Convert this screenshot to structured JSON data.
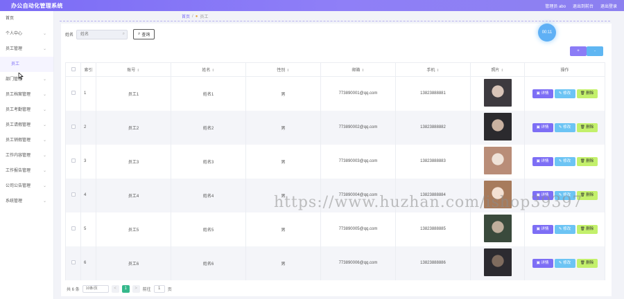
{
  "app": {
    "title": "办公自动化管理系统"
  },
  "header": {
    "admin_label": "管理员 abo",
    "back_label": "退出到前台",
    "logout_label": "退出登录"
  },
  "sidebar": {
    "items": [
      {
        "label": "首页",
        "has_arrow": false
      },
      {
        "label": "个人中心",
        "has_arrow": true
      },
      {
        "label": "员工管理",
        "has_arrow": true,
        "children": [
          "员工"
        ]
      },
      {
        "label": "部门管理",
        "has_arrow": true
      },
      {
        "label": "员工档案管理",
        "has_arrow": true
      },
      {
        "label": "员工考勤管理",
        "has_arrow": true
      },
      {
        "label": "员工请假管理",
        "has_arrow": true
      },
      {
        "label": "员工销假管理",
        "has_arrow": true
      },
      {
        "label": "工作内容管理",
        "has_arrow": true
      },
      {
        "label": "工作报告管理",
        "has_arrow": true
      },
      {
        "label": "公司公告管理",
        "has_arrow": true
      },
      {
        "label": "系统管理",
        "has_arrow": true
      }
    ]
  },
  "breadcrumb": {
    "home": "首页",
    "current": "员工"
  },
  "search": {
    "label": "姓名",
    "placeholder": "姓名",
    "button": "查询"
  },
  "timer": "00:11",
  "actions": {
    "add": "+",
    "delete": "-"
  },
  "table": {
    "headers": [
      "索引",
      "账号",
      "姓名",
      "性别",
      "邮箱",
      "手机",
      "照片",
      "操作"
    ],
    "sortable": [
      false,
      true,
      true,
      true,
      true,
      true,
      true,
      false
    ],
    "rows": [
      {
        "idx": "1",
        "account": "员工1",
        "name": "姓名1",
        "gender": "男",
        "email": "773890001@qq.com",
        "phone": "13823888881",
        "photo_colors": [
          "#3d3a3f",
          "#d8c4b8"
        ]
      },
      {
        "idx": "2",
        "account": "员工2",
        "name": "姓名2",
        "gender": "男",
        "email": "773890002@qq.com",
        "phone": "13823888882",
        "photo_colors": [
          "#2b2a2e",
          "#c9b1a0"
        ]
      },
      {
        "idx": "3",
        "account": "员工3",
        "name": "姓名3",
        "gender": "男",
        "email": "773890003@qq.com",
        "phone": "13823888883",
        "photo_colors": [
          "#b98d78",
          "#efe2d8"
        ]
      },
      {
        "idx": "4",
        "account": "员工4",
        "name": "姓名4",
        "gender": "男",
        "email": "773890004@qq.com",
        "phone": "13823888884",
        "photo_colors": [
          "#a77b5c",
          "#f3e1d3"
        ]
      },
      {
        "idx": "5",
        "account": "员工5",
        "name": "姓名5",
        "gender": "男",
        "email": "773890005@qq.com",
        "phone": "13823888885",
        "photo_colors": [
          "#3a4a3c",
          "#bfae9c"
        ]
      },
      {
        "idx": "6",
        "account": "员工6",
        "name": "姓名6",
        "gender": "男",
        "email": "773890006@qq.com",
        "phone": "13823888886",
        "photo_colors": [
          "#2c2b30",
          "#7f6c5e"
        ]
      }
    ],
    "op_labels": {
      "detail": "详情",
      "edit": "修改",
      "delete": "删除"
    }
  },
  "pager": {
    "total": "共 6 条",
    "page_size": "10条/页",
    "prev": "<",
    "page": "1",
    "next": ">",
    "goto_label": "前往",
    "goto_value": "1",
    "goto_suffix": "页"
  },
  "watermark": "https://www.huzhan.com/ishop39397"
}
